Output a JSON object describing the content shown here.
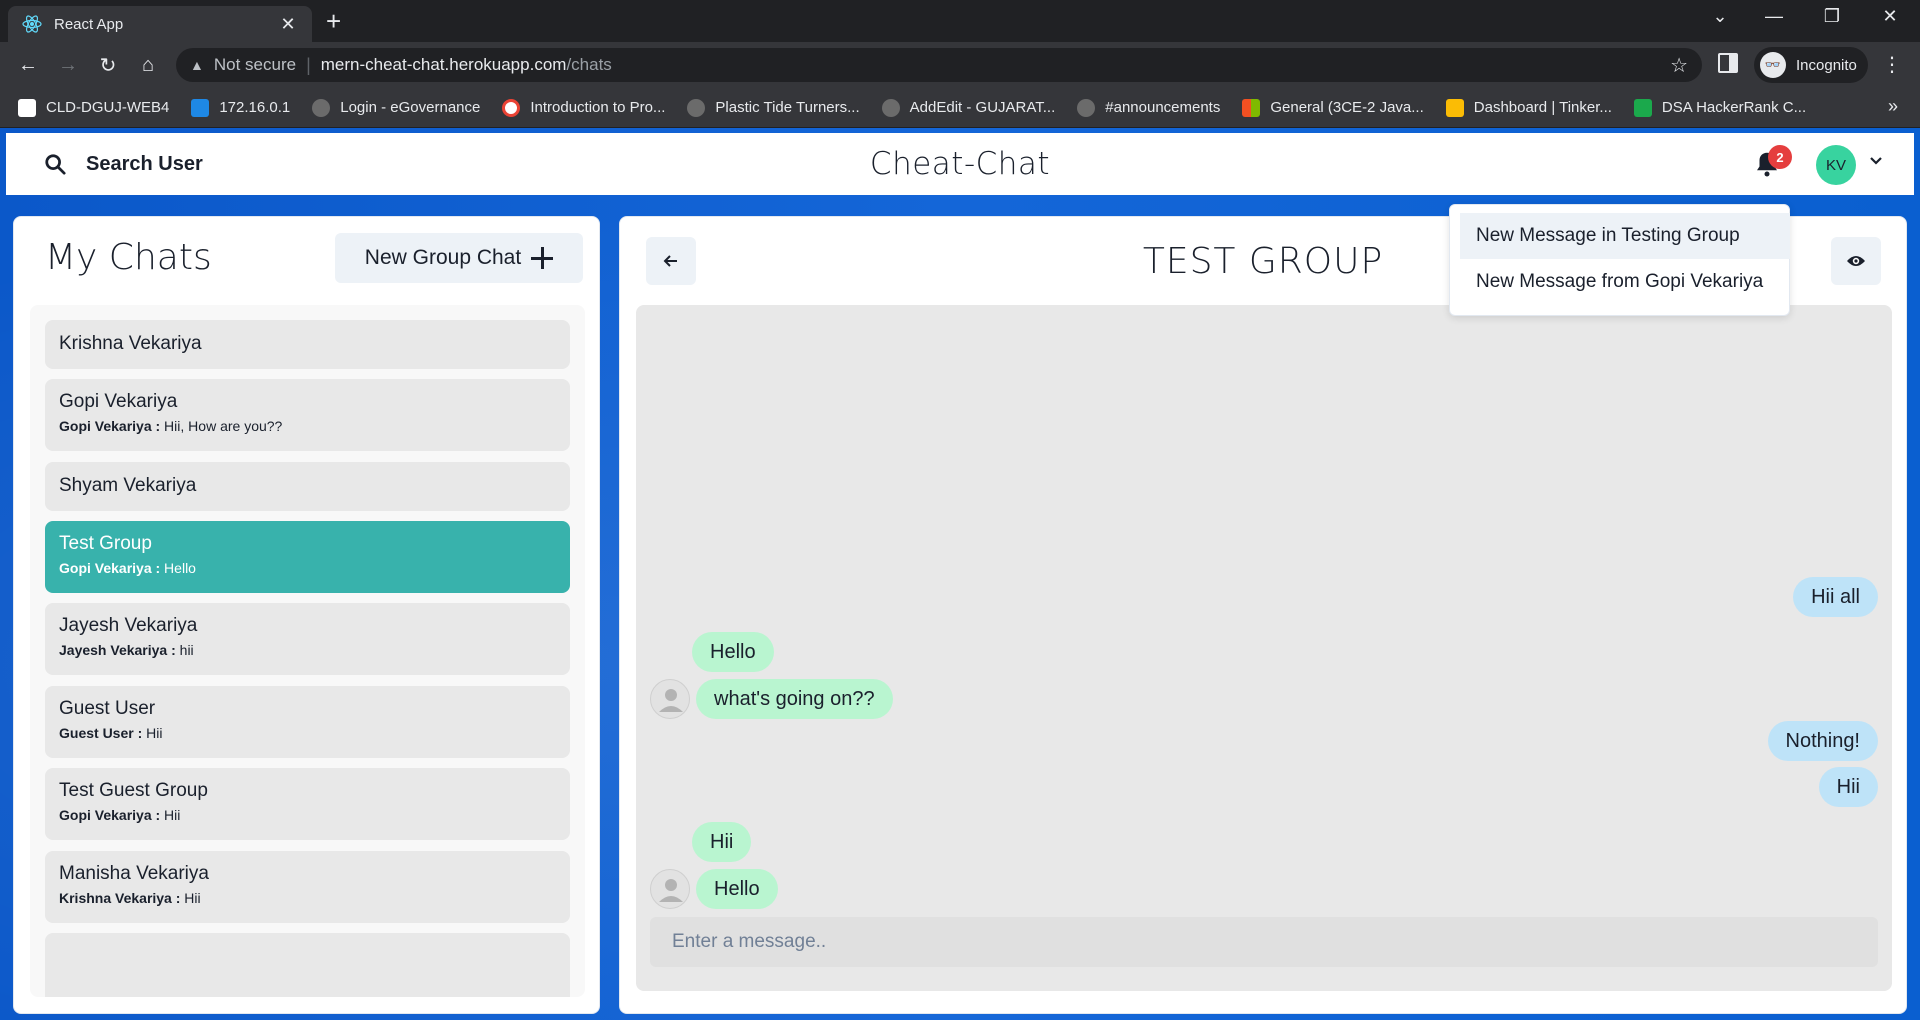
{
  "browser": {
    "tab_title": "React App",
    "new_tab_icon": "plus-icon",
    "address": {
      "security_label": "Not secure",
      "host": "mern-cheat-chat.herokuapp.com",
      "path": "/chats"
    },
    "profile_label": "Incognito",
    "bookmarks": [
      {
        "label": "CLD-DGUJ-WEB4",
        "color": "#ffffff"
      },
      {
        "label": "172.16.0.1",
        "color": "#1e88e5"
      },
      {
        "label": "Login - eGovernance",
        "color": "#9e9e9e"
      },
      {
        "label": "Introduction to Pro...",
        "color": "#ea4335"
      },
      {
        "label": "Plastic Tide Turners...",
        "color": "#9e9e9e"
      },
      {
        "label": "AddEdit - GUJARAT...",
        "color": "#9e9e9e"
      },
      {
        "label": "#announcements",
        "color": "#9e9e9e"
      },
      {
        "label": "General (3CE-2 Java...",
        "color": "#f25022"
      },
      {
        "label": "Dashboard | Tinker...",
        "color": "#fbbc05"
      },
      {
        "label": "DSA HackerRank C...",
        "color": "#1ba94c"
      }
    ]
  },
  "app": {
    "search_label": "Search User",
    "title": "Cheat-Chat",
    "notification_count": "2",
    "user_initials": "KV",
    "brand_color": "#38b2ac"
  },
  "sidebar": {
    "title": "My Chats",
    "new_group_label": "New Group Chat",
    "chats": [
      {
        "name": "Krishna Vekariya",
        "sender": "",
        "message": ""
      },
      {
        "name": "Gopi Vekariya",
        "sender": "Gopi Vekariya :",
        "message": " Hii, How are you??"
      },
      {
        "name": "Shyam Vekariya",
        "sender": "",
        "message": ""
      },
      {
        "name": "Test Group",
        "sender": "Gopi Vekariya :",
        "message": " Hello"
      },
      {
        "name": "Jayesh Vekariya",
        "sender": "Jayesh Vekariya :",
        "message": " hii"
      },
      {
        "name": "Guest User",
        "sender": "Guest User :",
        "message": " Hii"
      },
      {
        "name": "Test Guest Group",
        "sender": "Gopi Vekariya :",
        "message": " Hii"
      },
      {
        "name": "Manisha Vekariya",
        "sender": "Krishna Vekariya :",
        "message": " Hii"
      }
    ]
  },
  "chat": {
    "title": "TEST GROUP",
    "messages": [
      {
        "text": "Hii all",
        "from": "me"
      },
      {
        "text": "Hello",
        "from": "them"
      },
      {
        "text": "what's going on??",
        "from": "them"
      },
      {
        "text": "Nothing!",
        "from": "me"
      },
      {
        "text": "Hii",
        "from": "me"
      },
      {
        "text": "Hii",
        "from": "them"
      },
      {
        "text": "Hello",
        "from": "them"
      }
    ],
    "input_placeholder": "Enter a message.."
  },
  "notifications": {
    "items": [
      "New Message in Testing Group",
      "New Message from Gopi Vekariya"
    ]
  }
}
